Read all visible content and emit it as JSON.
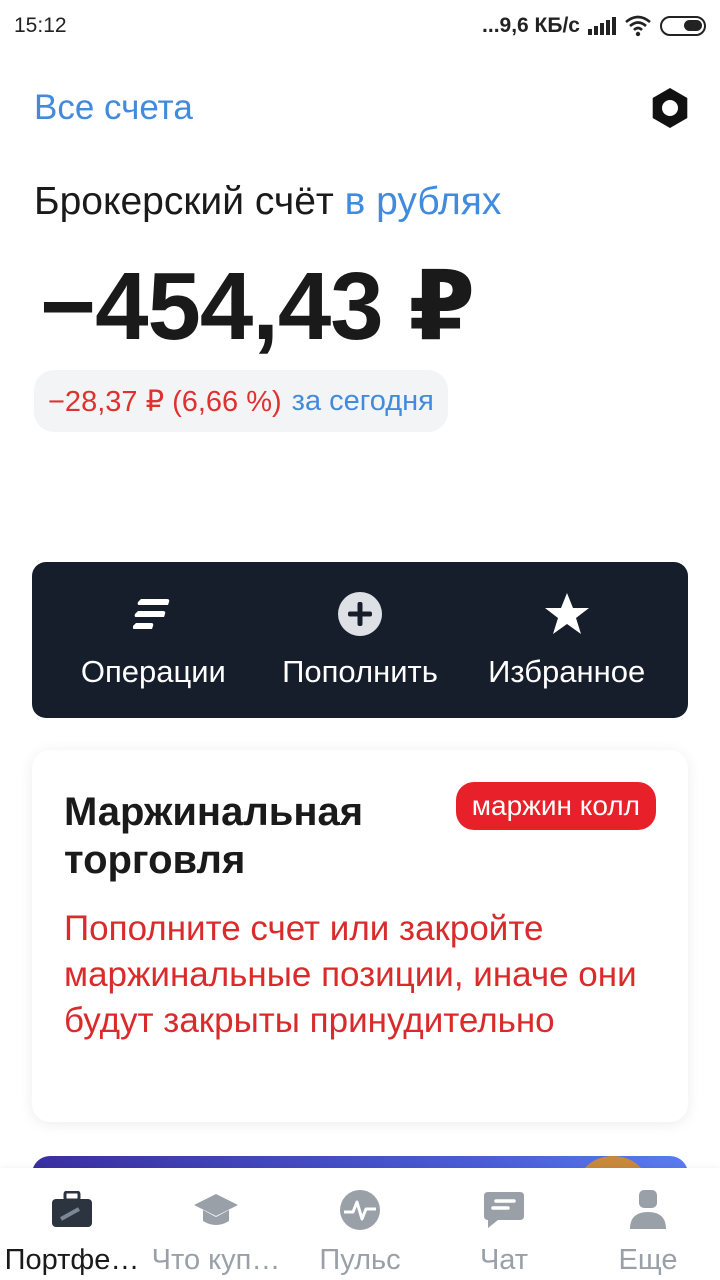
{
  "status_bar": {
    "time": "15:12",
    "network": "...9,6 КБ/с"
  },
  "header": {
    "all_accounts": "Все счета",
    "settings_icon": "hexagon-settings-icon"
  },
  "account": {
    "title": "Брокерский счёт",
    "currency_link": "в рублях",
    "balance": "−454,43 ₽",
    "change_value": "−28,37 ₽ (6,66 %)",
    "change_period": "за сегодня"
  },
  "actions": [
    {
      "label": "Операции",
      "icon": "operations-icon"
    },
    {
      "label": "Пополнить",
      "icon": "plus-circle-icon"
    },
    {
      "label": "Избранное",
      "icon": "star-icon"
    }
  ],
  "margin_card": {
    "title": "Маржинальная торговля",
    "badge": "маржин колл",
    "message": "Пополните счет или закройте маржинальные позиции, иначе они будут закрыты принудительно"
  },
  "tabs": [
    {
      "label": "Портфе…",
      "icon": "briefcase-icon",
      "active": true
    },
    {
      "label": "Что куп…",
      "icon": "graduation-cap-icon",
      "active": false
    },
    {
      "label": "Пульс",
      "icon": "pulse-icon",
      "active": false
    },
    {
      "label": "Чат",
      "icon": "chat-icon",
      "active": false
    },
    {
      "label": "Еще",
      "icon": "profile-icon",
      "active": false
    }
  ],
  "colors": {
    "accent_blue": "#428bdc",
    "negative_red": "#e03131",
    "badge_red": "#e8202a",
    "dark_panel": "#161e2c"
  }
}
